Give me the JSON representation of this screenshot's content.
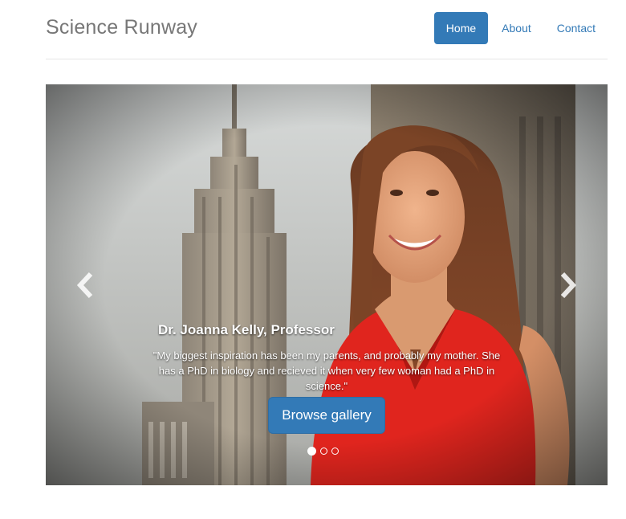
{
  "header": {
    "brand": "Science Runway",
    "nav": [
      {
        "label": "Home",
        "active": true
      },
      {
        "label": "About",
        "active": false
      },
      {
        "label": "Contact",
        "active": false
      }
    ]
  },
  "carousel": {
    "slide": {
      "title": "Dr. Joanna Kelly, Professor",
      "quote": "\"My biggest inspiration has been my parents, and probably my mother. She has a PhD in biology and recieved it when very few woman had a PhD in science.\"",
      "button_label": "Browse gallery"
    },
    "indicator_count": 3,
    "active_indicator": 0,
    "prev_icon": "chevron-left-icon",
    "next_icon": "chevron-right-icon"
  },
  "colors": {
    "primary": "#337ab7",
    "brand_text": "#777777",
    "dress": "#e0251e"
  }
}
